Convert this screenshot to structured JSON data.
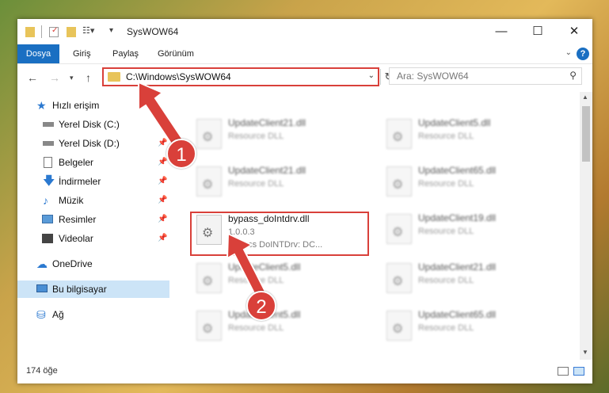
{
  "window": {
    "title": "SysWOW64"
  },
  "ribbon": {
    "tabs": [
      "Dosya",
      "Giriş",
      "Paylaş",
      "Görünüm"
    ]
  },
  "address": {
    "path": "C:\\Windows\\SysWOW64",
    "search_placeholder": "Ara: SysWOW64"
  },
  "navpane": {
    "items": [
      {
        "label": "Hızlı erişim",
        "icon": "star-icon"
      },
      {
        "label": "Yerel Disk (C:)",
        "icon": "drive-icon"
      },
      {
        "label": "Yerel Disk (D:)",
        "icon": "drive-icon"
      },
      {
        "label": "Belgeler",
        "icon": "document-icon"
      },
      {
        "label": "İndirmeler",
        "icon": "download-icon"
      },
      {
        "label": "Müzik",
        "icon": "music-icon"
      },
      {
        "label": "Resimler",
        "icon": "pictures-icon"
      },
      {
        "label": "Videolar",
        "icon": "video-icon"
      },
      {
        "label": "OneDrive",
        "icon": "cloud-icon"
      },
      {
        "label": "Bu bilgisayar",
        "icon": "computer-icon"
      },
      {
        "label": "Ağ",
        "icon": "network-icon"
      }
    ]
  },
  "files": [
    {
      "name": "UpdateClient21.dll",
      "desc": "Resource DLL"
    },
    {
      "name": "UpdateClient5.dll",
      "desc": "Resource DLL"
    },
    {
      "name": "UpdateClient21.dll",
      "desc": "Resource DLL"
    },
    {
      "name": "UpdateClient65.dll",
      "desc": "Resource DLL"
    },
    {
      "name": "bypass_doIntdrv.dll",
      "version": "1.0.0.3",
      "desc": "Bypass DoINTDrv: DC..."
    },
    {
      "name": "UpdateClient19.dll",
      "desc": "Resource DLL"
    },
    {
      "name": "UpdateClient5.dll",
      "desc": "Resource DLL"
    },
    {
      "name": "UpdateClient21.dll",
      "desc": "Resource DLL"
    },
    {
      "name": "UpdateClient5.dll",
      "desc": "Resource DLL"
    },
    {
      "name": "UpdateClient65.dll",
      "desc": "Resource DLL"
    }
  ],
  "status": {
    "count": "174 öğe"
  },
  "annotations": {
    "step1": "1",
    "step2": "2",
    "color": "#d9403a"
  }
}
